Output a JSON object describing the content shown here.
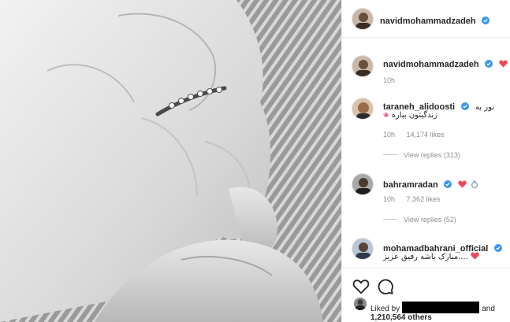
{
  "post": {
    "author": "navidmohammadzadeh",
    "verified": true
  },
  "caption": {
    "username": "navidmohammadzadeh",
    "emoji": "red-heart",
    "time": "10h"
  },
  "comments": [
    {
      "username": "taraneh_alidoosti",
      "line1": "نور به",
      "line2": "زندگیتون بباره",
      "time": "10h",
      "likes": "14,174 likes",
      "replies": "View replies (313)"
    },
    {
      "username": "bahramradan",
      "emoji": "red-heart ring",
      "time": "10h",
      "likes": "7,362 likes",
      "replies": "View replies (52)"
    },
    {
      "username": "mohamadbahrani_official",
      "line1": "....مبارک باشه رفیق عزیز",
      "emoji": "red-heart"
    }
  ],
  "footer": {
    "liked_by_prefix": "Liked by",
    "liked_by_suffix": "and",
    "others": "1,210,564 others"
  },
  "colors": {
    "verified": "#3897f0",
    "heart": "#ed4956",
    "muted": "#8e8e8e"
  },
  "icons": [
    "heart-outline-icon",
    "comment-icon",
    "verified-badge-icon",
    "heart-emoji-icon",
    "ring-emoji-icon"
  ]
}
